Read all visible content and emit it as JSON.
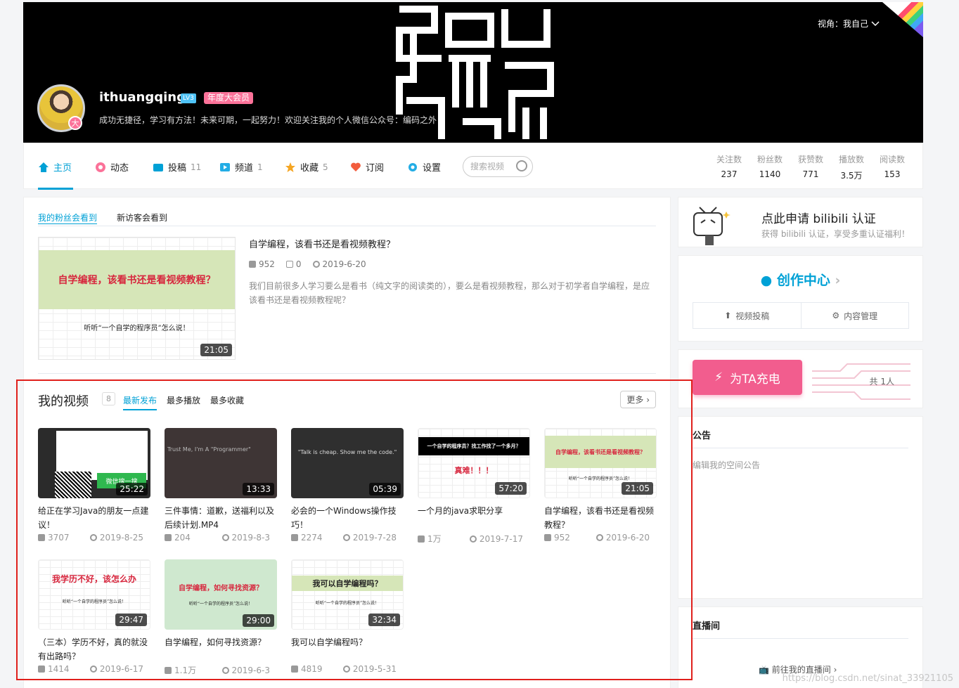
{
  "banner": {
    "view_label": "视角：我自己",
    "username": "ithuangqing",
    "level": "LV3",
    "vip": "年度大会员",
    "avatar_badge": "大",
    "sign": "成功无捷径，学习有方法！未来可期，一起努力！欢迎关注我的个人微信公众号：编码之外"
  },
  "nav": {
    "items": [
      {
        "label": "主页",
        "count": ""
      },
      {
        "label": "动态",
        "count": ""
      },
      {
        "label": "投稿",
        "count": "11"
      },
      {
        "label": "频道",
        "count": "1"
      },
      {
        "label": "收藏",
        "count": "5"
      },
      {
        "label": "订阅",
        "count": ""
      },
      {
        "label": "设置",
        "count": ""
      }
    ],
    "search_placeholder": "搜索视频",
    "stats": [
      {
        "label": "关注数",
        "value": "237"
      },
      {
        "label": "粉丝数",
        "value": "1140"
      },
      {
        "label": "获赞数",
        "value": "771"
      },
      {
        "label": "播放数",
        "value": "3.5万"
      },
      {
        "label": "阅读数",
        "value": "153"
      }
    ]
  },
  "featured": {
    "tab_fans": "我的粉丝会看到",
    "tab_new": "新访客会看到",
    "thumb_text": "自学编程，该看书还是看视频教程？",
    "thumb_sub": "听听“一个自学的程序员”怎么说！",
    "duration": "21:05",
    "title": "自学编程，该看书还是看视频教程？",
    "plays": "952",
    "comments": "0",
    "date": "2019-6-20",
    "desc": "我们目前很多人学习要么是看书（纯文字的阅读类的），要么是看视频教程，那么对于初学者自学编程，是应该看书还是看视频教程呢？"
  },
  "videos": {
    "title": "我的视频",
    "count": "8",
    "tabs": [
      "最新发布",
      "最多播放",
      "最多收藏"
    ],
    "more": "更多",
    "items": [
      {
        "title": "给正在学习Java的朋友一点建议！",
        "duration": "25:22",
        "plays": "3707",
        "date": "2019-8-25",
        "thumb_text": "微信搜一搜"
      },
      {
        "title": "三件事情：道歉，送福利以及后续计划.MP4",
        "duration": "13:33",
        "plays": "204",
        "date": "2019-8-3",
        "thumb_text": "Trust Me, I'm A \"Programmer\""
      },
      {
        "title": "必会的一个Windows操作技巧！",
        "duration": "05:39",
        "plays": "2274",
        "date": "2019-7-28",
        "thumb_text": "\"Talk is cheap. Show me the code.\""
      },
      {
        "title": "一个月的java求职分享",
        "duration": "57:20",
        "plays": "1万",
        "date": "2019-7-17",
        "thumb_text": "一个自学的程序员？找工作找了一个多月？",
        "thumb_sub": "真难！！！"
      },
      {
        "title": "自学编程，该看书还是看视频教程？",
        "duration": "21:05",
        "plays": "952",
        "date": "2019-6-20",
        "thumb_text": "自学编程，该看书还是看视频教程？",
        "thumb_sub": "听听“一个自学的程序员”怎么说！"
      },
      {
        "title": "（三本）学历不好，真的就没有出路吗？",
        "duration": "29:47",
        "plays": "1414",
        "date": "2019-6-17",
        "thumb_text": "我学历不好，该怎么办",
        "thumb_sub": "听听“一个自学的程序员”怎么说！"
      },
      {
        "title": "自学编程，如何寻找资源？",
        "duration": "29:00",
        "plays": "1.1万",
        "date": "2019-6-3",
        "thumb_text": "自学编程，如何寻找资源？",
        "thumb_sub": "听听“一个自学的程序员”怎么说！"
      },
      {
        "title": "我可以自学编程吗？",
        "duration": "32:34",
        "plays": "4819",
        "date": "2019-5-31",
        "thumb_text": "我可以自学编程吗？",
        "thumb_sub": "听听“一个自学的程序员”怎么说！"
      }
    ]
  },
  "sidebar": {
    "cert_title": "点此申请 bilibili 认证",
    "cert_sub": "获得 bilibili 认证，享受多重认证福利！",
    "creator_title": "创作中心",
    "upload_label": "视频投稿",
    "manage_label": "内容管理",
    "charge_label": "为TA充电",
    "charge_total": "共 1人",
    "notice_title": "公告",
    "notice_edit": "编辑我的空间公告",
    "live_title": "直播间",
    "live_link": "前往我的直播间"
  },
  "watermark": "https://blog.csdn.net/sinat_33921105",
  "colors": {
    "accent": "#00a1d6",
    "pink": "#fb7299",
    "highlight_box": "#e0201c"
  }
}
